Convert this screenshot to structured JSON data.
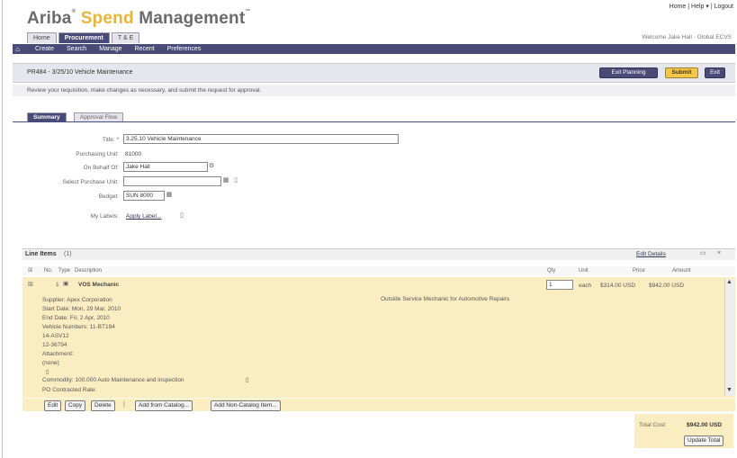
{
  "app": {
    "logo_brand": "Ariba",
    "logo_spend": "Spend",
    "logo_rest": "Management",
    "toplinks": "Home | Help ▾ | Logout",
    "welcome": "Welcome Jake Hall · Global ECVS"
  },
  "tabs": [
    "Home",
    "Procurement",
    "T & E"
  ],
  "nav": [
    "Create",
    "Search",
    "Manage",
    "Recent",
    "Preferences"
  ],
  "titlebar": {
    "title": "PR484 - 3/25/10 Vehicle Maintenance",
    "btn_exit_planning": "Exit Planning",
    "btn_submit": "Submit",
    "btn_exit": "Exit"
  },
  "instruction": "Review your requisition, make changes as necessary, and submit the request for approval.",
  "subtabs": [
    "Summary",
    "Approval Flow"
  ],
  "form": {
    "title_label": "Title: *",
    "title_value": "3.25.10 Vehicle Maintenance",
    "unit_label": "Purchasing Unit:",
    "unit_value": "81000",
    "onbehalf_label": "On Behalf Of:",
    "onbehalf_value": "Jake Hall",
    "parent_label": "Select Purchase Unit:",
    "parent_value": "",
    "budget_label": "Budget:",
    "budget_value": "SUN 8000",
    "labels_label": "My Labels:",
    "labels_link": "Apply Label..."
  },
  "lineitems": {
    "header": "Line Items",
    "count": "(1)",
    "edit_details": "Edit Details",
    "columns": [
      "No.",
      "Type",
      "Description",
      "Qty",
      "Unit",
      "Price",
      "Amount"
    ],
    "row": {
      "no": "1",
      "description": "VOS Mechanic",
      "qty": "1",
      "unit": "each",
      "price": "$314.00 USD",
      "amount": "$942.00 USD",
      "supplier": "Supplier:  Apex Corporation",
      "start": "Start Date:   Mon, 29 Mar, 2010",
      "end": "End Date:   Fri, 2 Apr, 2010",
      "vehicle": "Vehicle Numbers:   11-BT194",
      "vehicle2": "14-ASV12",
      "vehicle3": "12-36794",
      "attachment": "Attachment:",
      "attachment_value": "(none)",
      "commodity": "Commodity:   100.000 Auto Maintenance and inspection",
      "contract": "PO Contracted Rate:",
      "long_desc": "Outside Service Mechanic for Automotive Repairs"
    },
    "buttons": [
      "Edit",
      "Copy",
      "Delete",
      "Add from Catalog...",
      "Add Non-Catalog Item..."
    ]
  },
  "totals": {
    "label": "Total Cost:",
    "value": "$942.00 USD",
    "update": "Update Total"
  }
}
